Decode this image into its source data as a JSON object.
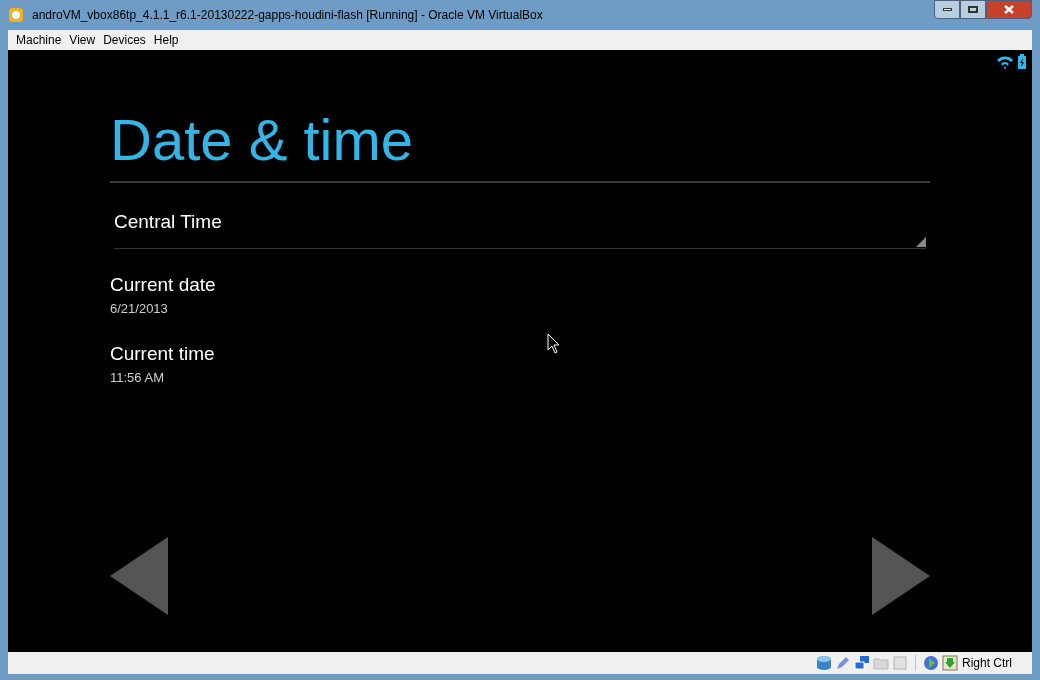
{
  "window": {
    "title": "androVM_vbox86tp_4.1.1_r6.1-20130222-gapps-houdini-flash [Running] - Oracle VM VirtualBox"
  },
  "menu": [
    "Machine",
    "View",
    "Devices",
    "Help"
  ],
  "guest": {
    "heading": "Date & time",
    "timezone": "Central Time",
    "settings": [
      {
        "title": "Current date",
        "value": "6/21/2013"
      },
      {
        "title": "Current time",
        "value": "11:56 AM"
      }
    ]
  },
  "status_bar": {
    "host_key": "Right Ctrl"
  }
}
